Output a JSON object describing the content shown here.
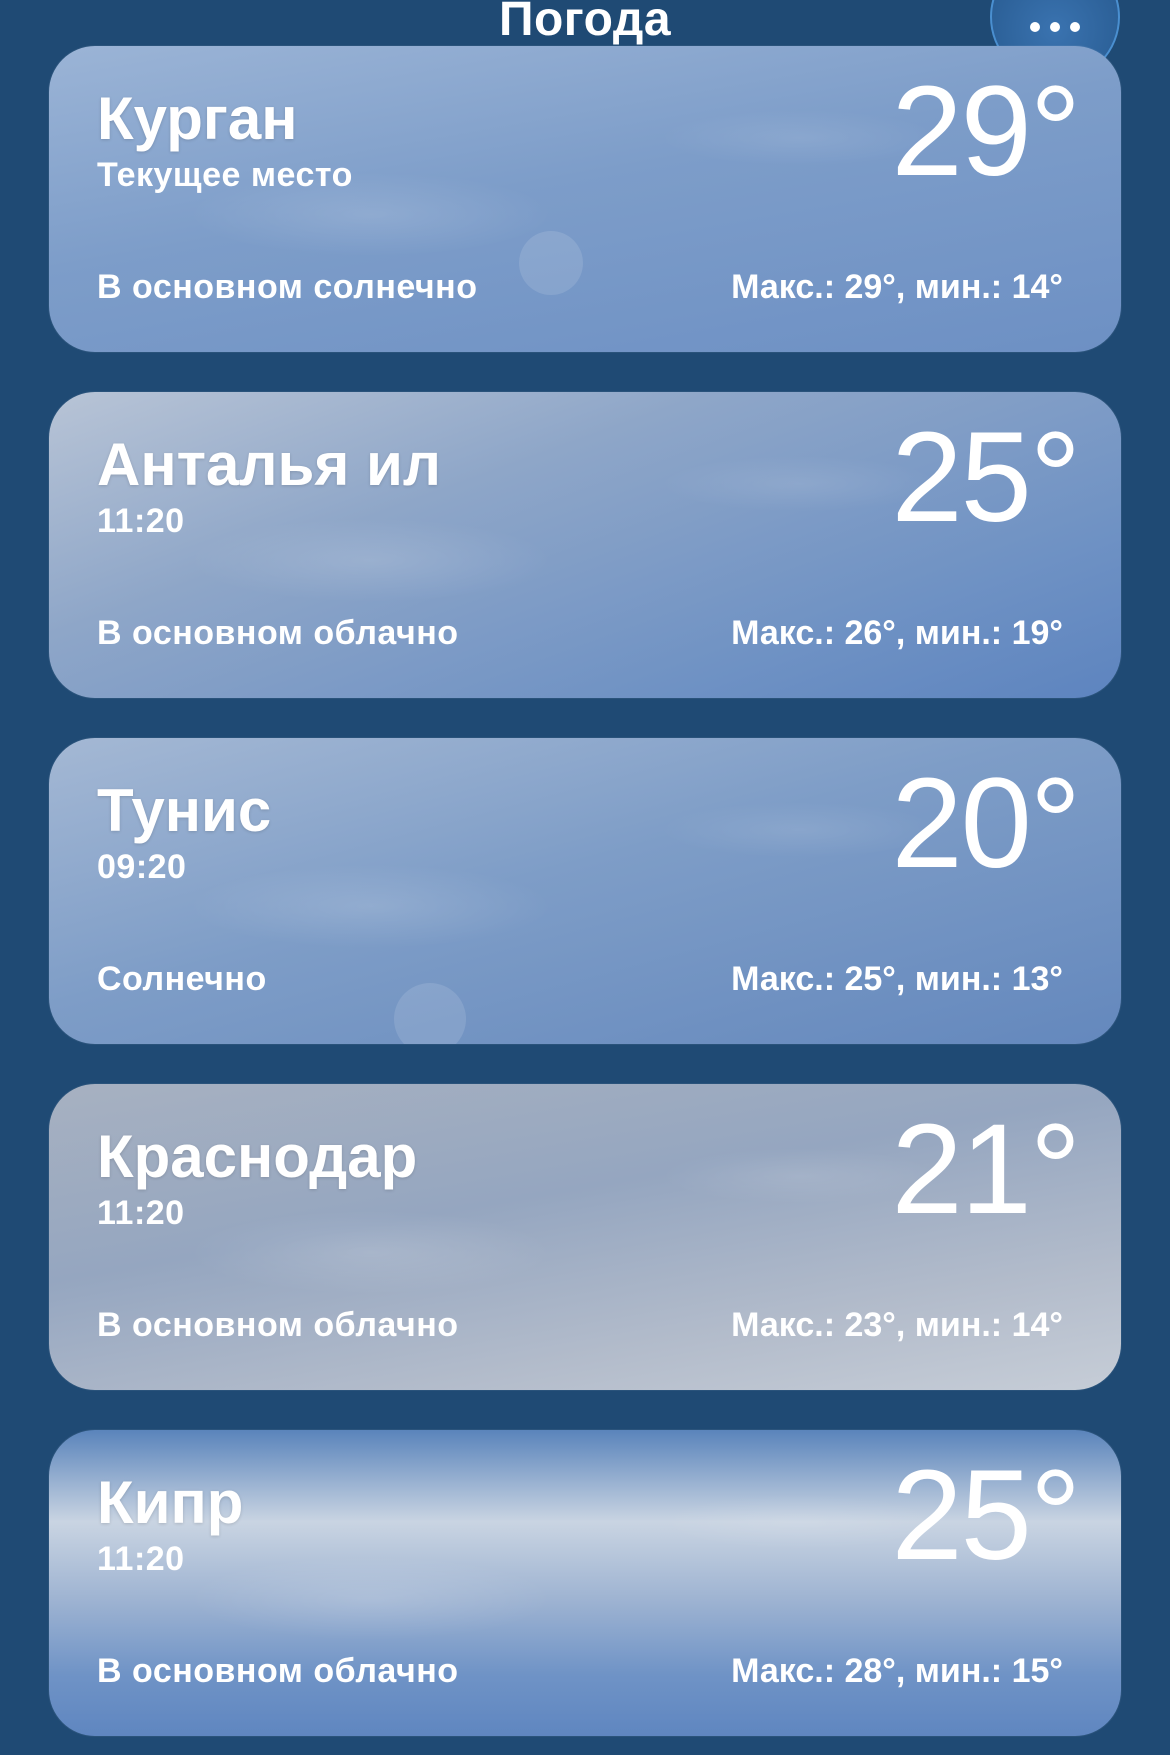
{
  "header": {
    "title": "Погода",
    "more_icon": "ellipsis-icon"
  },
  "locations": [
    {
      "city": "Курган",
      "subtitle": "Текущее место",
      "temp": "29°",
      "condition": "В основном солнечно",
      "range": "Макс.: 29°, мин.: 14°"
    },
    {
      "city": "Анталья ил",
      "subtitle": "11:20",
      "temp": "25°",
      "condition": "В основном облачно",
      "range": "Макс.: 26°, мин.: 19°"
    },
    {
      "city": "Тунис",
      "subtitle": "09:20",
      "temp": "20°",
      "condition": "Солнечно",
      "range": "Макс.: 25°, мин.: 13°"
    },
    {
      "city": "Краснодар",
      "subtitle": "11:20",
      "temp": "21°",
      "condition": "В основном облачно",
      "range": "Макс.: 23°, мин.: 14°"
    },
    {
      "city": "Кипр",
      "subtitle": "11:20",
      "temp": "25°",
      "condition": "В основном облачно",
      "range": "Макс.: 28°, мин.: 15°"
    }
  ]
}
